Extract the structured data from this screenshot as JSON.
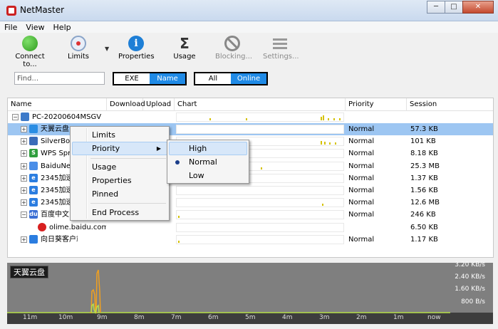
{
  "window": {
    "title": "NetMaster",
    "min_label": "─",
    "max_label": "□",
    "close_label": "✕"
  },
  "menu": [
    "File",
    "View",
    "Help"
  ],
  "toolbar": {
    "connect": "Connect to...",
    "limits": "Limits",
    "properties": "Properties",
    "properties_glyph": "i",
    "usage": "Usage",
    "usage_glyph": "Σ",
    "blocking": "Blocking...",
    "settings": "Settings...",
    "dropdown_glyph": "▼"
  },
  "filters": {
    "find_placeholder": "Find...",
    "exe": "EXE",
    "name": "Name",
    "all": "All",
    "online": "Online"
  },
  "columns": [
    "Name",
    "Download",
    "Upload",
    "Chart",
    "Priority",
    "Session"
  ],
  "host": {
    "name": "PC-20200604MSGV",
    "expander": "−"
  },
  "rows": [
    {
      "name": "天翼云盘",
      "priority": "Normal",
      "session": "57.3 KB",
      "icon_color": "#2a8de3",
      "expander": "+"
    },
    {
      "name": "SilverBoxC",
      "priority": "Normal",
      "session": "101 KB",
      "icon_color": "#3a6bb8",
      "expander": "+"
    },
    {
      "name": "WPS Sprea",
      "priority": "Normal",
      "session": "8.18 KB",
      "icon_color": "#2f9e3e",
      "icon_glyph": "S",
      "expander": "+"
    },
    {
      "name": "BaiduNetd",
      "priority": "Normal",
      "session": "25.3 MB",
      "icon_color": "#4a8ee8",
      "expander": "+"
    },
    {
      "name": "2345加速",
      "priority": "Normal",
      "session": "1.37 KB",
      "icon_color": "#2b7de0",
      "icon_glyph": "e",
      "expander": "+"
    },
    {
      "name": "2345加速",
      "priority": "Normal",
      "session": "1.56 KB",
      "icon_color": "#2b7de0",
      "icon_glyph": "e",
      "expander": "+"
    },
    {
      "name": "2345加速",
      "priority": "Normal",
      "session": "12.6 MB",
      "icon_color": "#2b7de0",
      "icon_glyph": "e",
      "expander": "+"
    },
    {
      "name": "百度中文",
      "priority": "Normal",
      "session": "246 KB",
      "icon_color": "#3b6fd4",
      "icon_glyph": "du",
      "expander": "−"
    },
    {
      "name": "olime.baidu.com...",
      "priority": "",
      "session": "6.50 KB",
      "icon_color": "#d82020",
      "expander": ""
    },
    {
      "name": "向日葵客户端",
      "priority": "Normal",
      "session": "1.17 KB",
      "icon_color": "#2b7de0",
      "expander": "+"
    }
  ],
  "context_menu": {
    "items": [
      "Limits",
      "Priority",
      "Usage",
      "Properties",
      "Pinned",
      "End Process"
    ],
    "submenu_arrow": "▶"
  },
  "priority_submenu": {
    "items": [
      "High",
      "Normal",
      "Low"
    ],
    "selected": "Normal"
  },
  "graph": {
    "label": "天翼云盘",
    "y_ticks": [
      "3.20 KB/s",
      "2.40 KB/s",
      "1.60 KB/s",
      "800 B/s"
    ],
    "x_ticks": [
      "11m",
      "10m",
      "9m",
      "8m",
      "7m",
      "6m",
      "5m",
      "4m",
      "3m",
      "2m",
      "1m",
      "now"
    ],
    "colors": {
      "download": "#f0a020",
      "upload": "#b8e04a"
    }
  }
}
